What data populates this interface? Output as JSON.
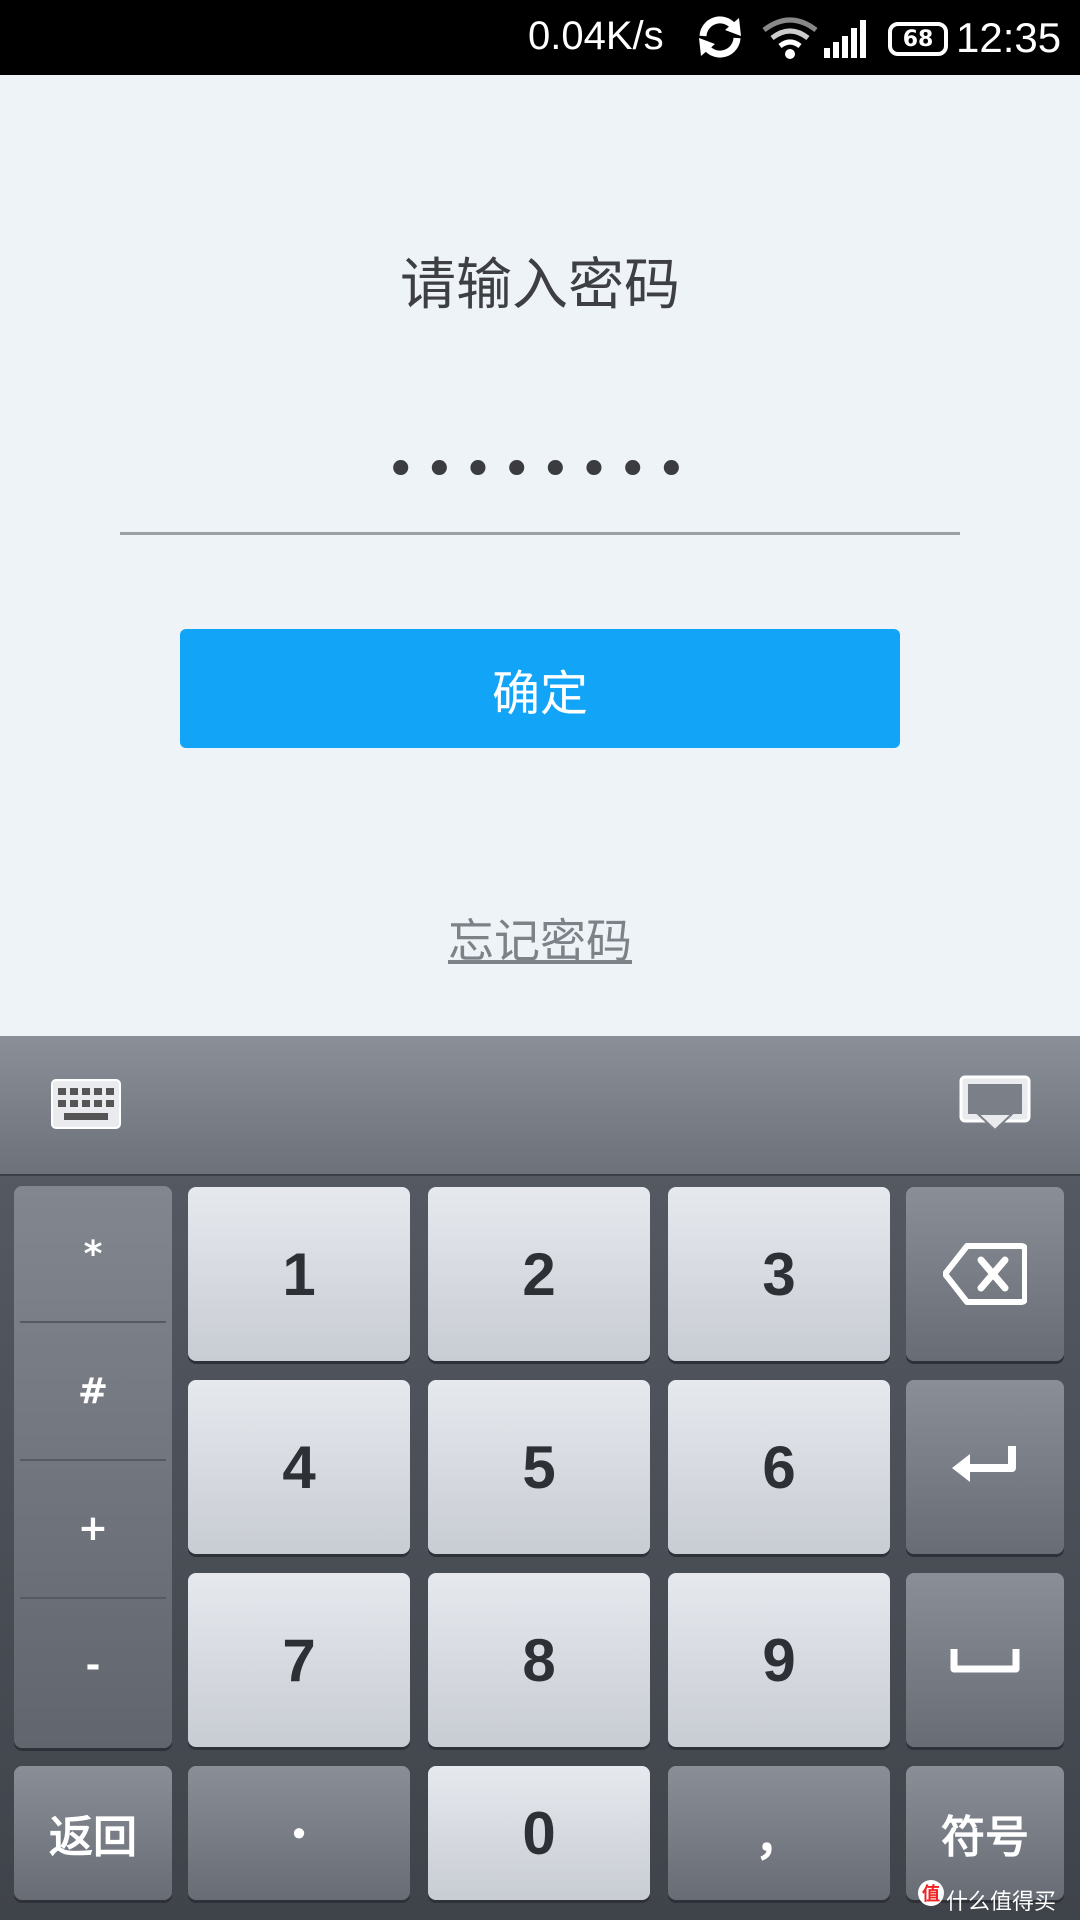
{
  "status_bar": {
    "net_speed": "0.04K/s",
    "battery_level": "68",
    "time": "12:35",
    "icons": [
      "sync-icon",
      "wifi-icon",
      "signal-icon",
      "battery-icon"
    ]
  },
  "main": {
    "title": "请输入密码",
    "password_mask": "••••••••",
    "confirm_label": "确定",
    "forgot_label": "忘记密码",
    "accent_color": "#12a4f7"
  },
  "keyboard": {
    "toolbar_icons": [
      "keyboard-icon",
      "hide-keyboard-icon"
    ],
    "symbols": [
      "*",
      "#",
      "+",
      "-"
    ],
    "digits": {
      "k1": "1",
      "k2": "2",
      "k3": "3",
      "k4": "4",
      "k5": "5",
      "k6": "6",
      "k7": "7",
      "k8": "8",
      "k9": "9",
      "k0": "0"
    },
    "back_label": "返回",
    "dot_label": "•",
    "comma_label": "，",
    "symbol_label": "符号",
    "action_icons": [
      "backspace-icon",
      "enter-icon",
      "space-icon"
    ]
  },
  "watermark": {
    "badge": "值",
    "text": "什么值得买"
  }
}
